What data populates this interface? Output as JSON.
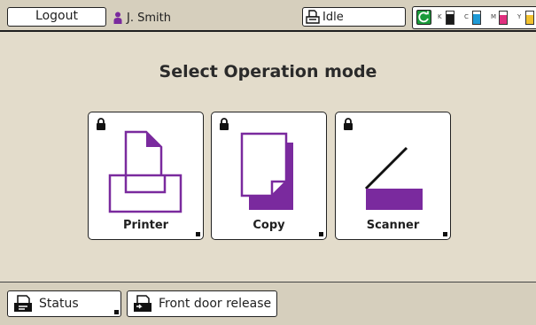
{
  "topbar": {
    "logout_label": "Logout",
    "user_name": "J. Smith",
    "status_label": "Idle",
    "inks": [
      {
        "label": "K",
        "level": 0.8,
        "color": "#1a1a1a"
      },
      {
        "label": "C",
        "level": 0.8,
        "color": "#1e9ad6"
      },
      {
        "label": "M",
        "level": 0.75,
        "color": "#e0307f"
      },
      {
        "label": "Y",
        "level": 0.7,
        "color": "#f2c230"
      }
    ],
    "accent_color": "#7a2a9e"
  },
  "main": {
    "title": "Select Operation mode",
    "tiles": [
      {
        "label": "Printer",
        "icon": "printer-icon",
        "locked": true
      },
      {
        "label": "Copy",
        "icon": "copy-icon",
        "locked": true
      },
      {
        "label": "Scanner",
        "icon": "scanner-icon",
        "locked": true
      }
    ]
  },
  "footer": {
    "status_label": "Status",
    "door_label": "Front door release"
  }
}
